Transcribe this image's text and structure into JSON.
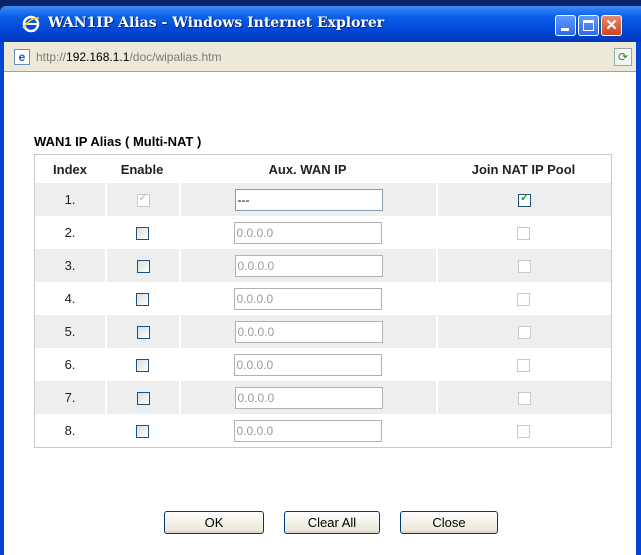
{
  "window": {
    "title": "WAN1IP Alias - Windows Internet Explorer",
    "address_prefix": "http://",
    "address_host": "192.168.1.1",
    "address_path": "/doc/wipalias.htm"
  },
  "page": {
    "section_title": "WAN1 IP Alias ( Multi-NAT )",
    "columns": [
      "Index",
      "Enable",
      "Aux. WAN IP",
      "Join NAT IP Pool"
    ],
    "rows": [
      {
        "index": "1.",
        "enable": "checked-disabled",
        "ip_value": "---",
        "ip_placeholder": "",
        "join": "checked"
      },
      {
        "index": "2.",
        "enable": "unchecked",
        "ip_value": "",
        "ip_placeholder": "0.0.0.0",
        "join": "disabled"
      },
      {
        "index": "3.",
        "enable": "unchecked",
        "ip_value": "",
        "ip_placeholder": "0.0.0.0",
        "join": "disabled"
      },
      {
        "index": "4.",
        "enable": "unchecked",
        "ip_value": "",
        "ip_placeholder": "0.0.0.0",
        "join": "disabled"
      },
      {
        "index": "5.",
        "enable": "unchecked",
        "ip_value": "",
        "ip_placeholder": "0.0.0.0",
        "join": "disabled"
      },
      {
        "index": "6.",
        "enable": "unchecked",
        "ip_value": "",
        "ip_placeholder": "0.0.0.0",
        "join": "disabled"
      },
      {
        "index": "7.",
        "enable": "unchecked",
        "ip_value": "",
        "ip_placeholder": "0.0.0.0",
        "join": "disabled"
      },
      {
        "index": "8.",
        "enable": "unchecked",
        "ip_value": "",
        "ip_placeholder": "0.0.0.0",
        "join": "disabled"
      }
    ],
    "buttons": {
      "ok": "OK",
      "clear_all": "Clear All",
      "close": "Close"
    }
  },
  "icons": {
    "browser": "ie-logo-icon",
    "page": "page-icon",
    "go": "refresh-go-icon"
  }
}
